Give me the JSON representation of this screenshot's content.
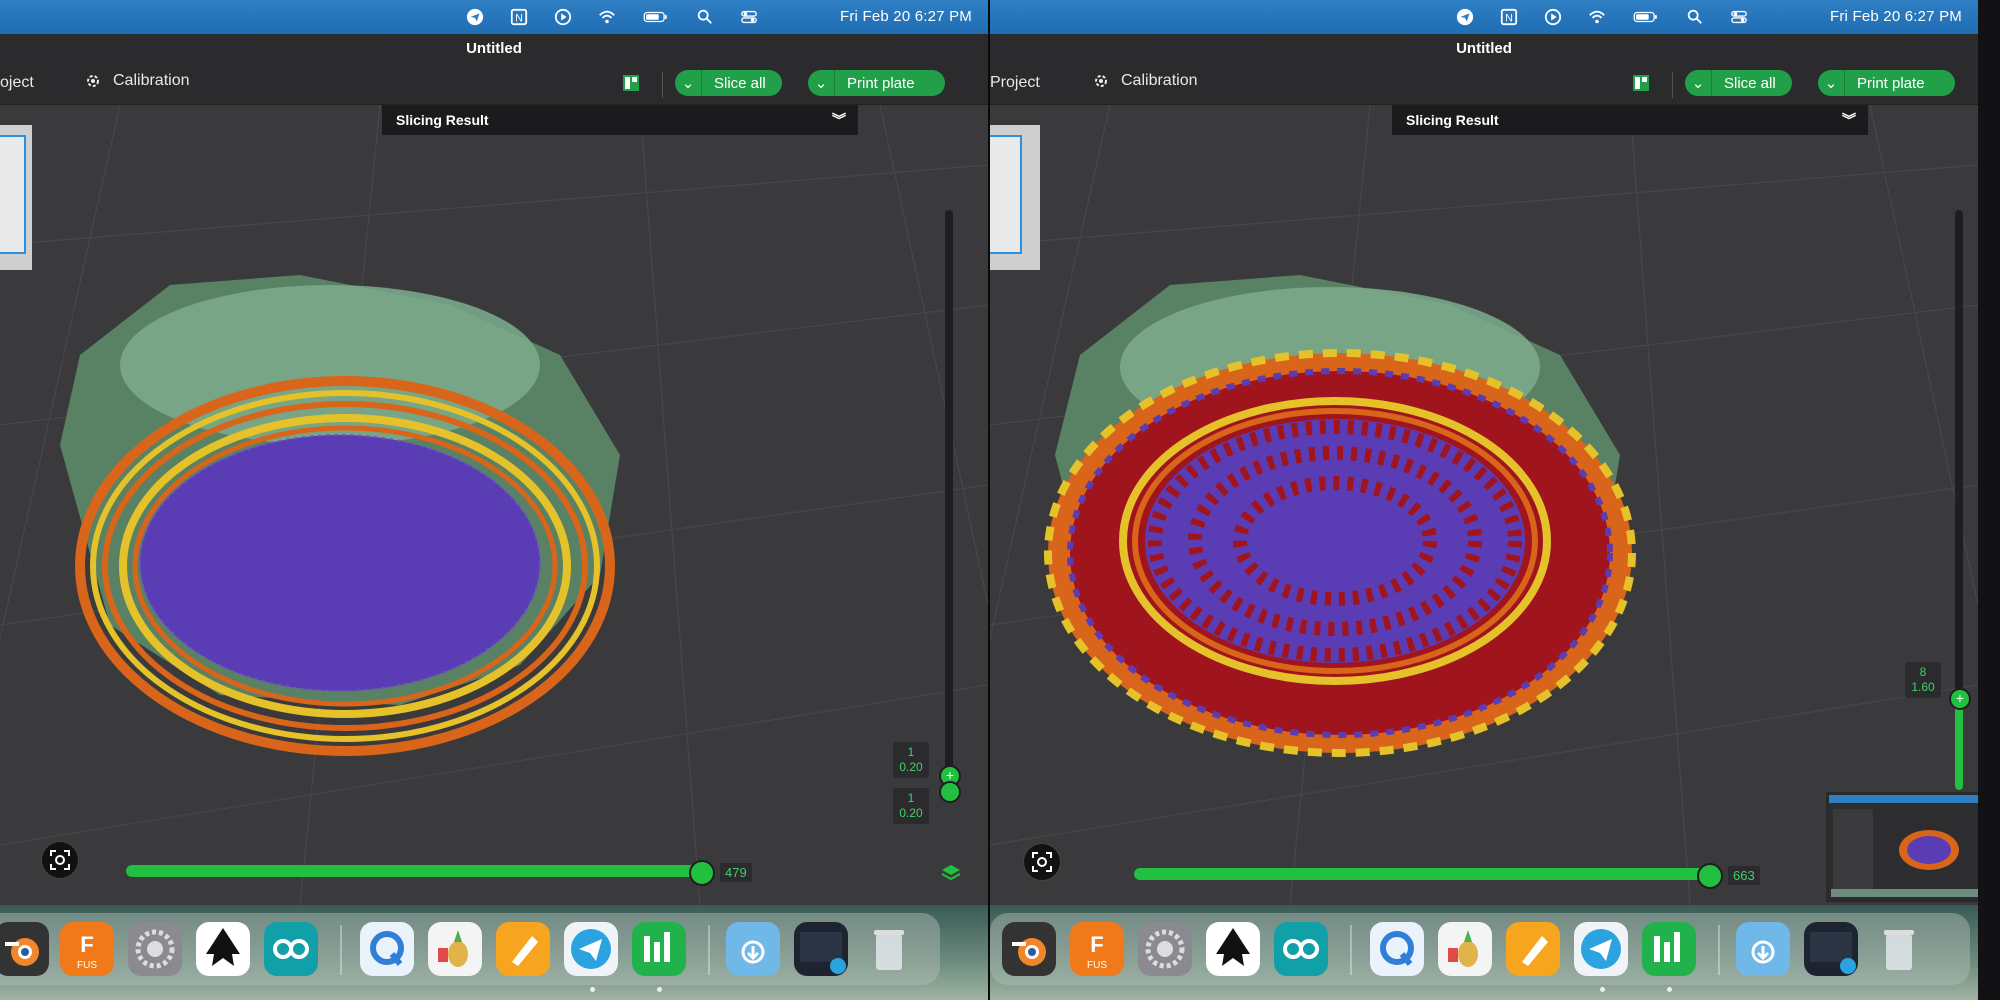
{
  "left": {
    "clock": "Fri Feb 20  6:27 PM",
    "window_title": "Untitled",
    "toolbar": {
      "project": "oject",
      "calibration": "Calibration",
      "slice_all": "Slice all",
      "print_plate": "Print plate"
    },
    "slicing_result": "Slicing Result",
    "layer_top": {
      "num": "1",
      "height": "0.20"
    },
    "layer_bottom": {
      "num": "1",
      "height": "0.20"
    },
    "move_value": "479",
    "move_fraction": 0.99
  },
  "right": {
    "clock": "Fri Feb 20  6:27 PM",
    "window_title": "Untitled",
    "toolbar": {
      "project": "Project",
      "calibration": "Calibration",
      "slice_all": "Slice all",
      "print_plate": "Print plate"
    },
    "slicing_result": "Slicing Result",
    "layer_top": {
      "num": "8",
      "height": "1.60"
    },
    "move_value": "663",
    "move_fraction": 0.99
  },
  "menubar_icons": [
    "telegram-icon",
    "notion-icon",
    "play-icon",
    "wifi-icon",
    "battery-icon",
    "search-icon",
    "control-center-icon"
  ],
  "dock_icons": [
    "blender-icon",
    "fusion-icon",
    "system-settings-icon",
    "inkscape-icon",
    "arduino-icon",
    "quicktime-icon",
    "cider-icon",
    "pages-icon",
    "telegram-icon",
    "numbers-icon",
    "downloads-folder-icon",
    "screenshot-icon",
    "trash-icon"
  ],
  "colors": {
    "accent_green": "#22a049",
    "menubar_blue": "#2f7fc4",
    "model_green": "#5f8f6c",
    "inner_purple": "#5a3cb4",
    "wall_orange": "#d8651a",
    "wall_yellow": "#e6c22a",
    "infill_red": "#a0141e"
  }
}
